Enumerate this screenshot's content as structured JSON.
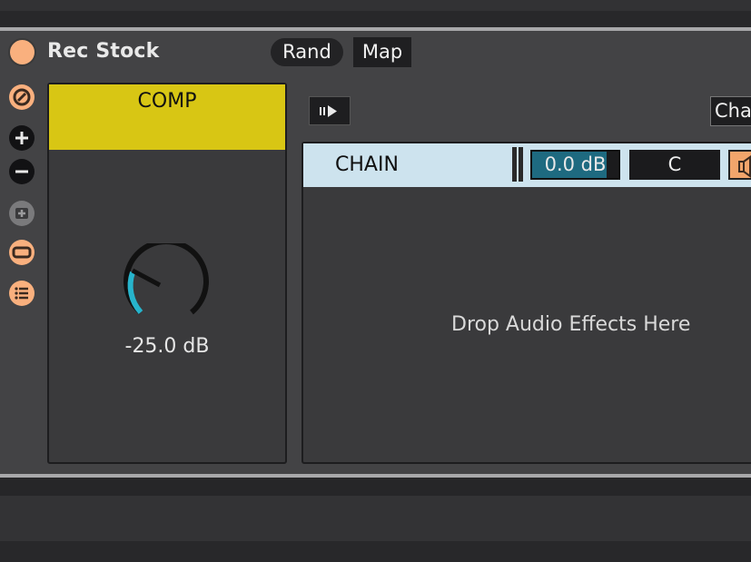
{
  "device": {
    "name": "Rec Stock",
    "rand_label": "Rand",
    "map_label": "Map"
  },
  "sidebar": {
    "icons": [
      "hot-swap-icon",
      "add-icon",
      "remove-icon",
      "save-preset-icon",
      "collapse-icon",
      "list-icon"
    ],
    "accent": "#f9b07e"
  },
  "macro": {
    "label": "COMP",
    "value": "-25.0 dB",
    "header_color": "#d8c614",
    "knob_color": "#27b4cc"
  },
  "chain_panel": {
    "header_button_label": "Cha",
    "chain": {
      "name": "CHAIN",
      "volume": "0.0 dB",
      "pan": "C"
    },
    "drop_hint": "Drop Audio Effects Here"
  }
}
